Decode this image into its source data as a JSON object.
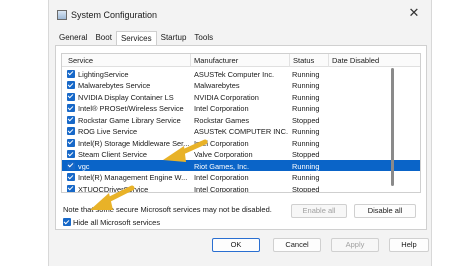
{
  "window": {
    "title": "System Configuration",
    "close_glyph": "✕"
  },
  "tabs": [
    {
      "label": "General",
      "active": false
    },
    {
      "label": "Boot",
      "active": false
    },
    {
      "label": "Services",
      "active": true
    },
    {
      "label": "Startup",
      "active": false
    },
    {
      "label": "Tools",
      "active": false
    }
  ],
  "list": {
    "columns": [
      "Service",
      "Manufacturer",
      "Status",
      "Date Disabled"
    ],
    "rows": [
      {
        "name": "LightingService",
        "manufacturer": "ASUSTek Computer Inc.",
        "status": "Running",
        "checked": true,
        "selected": false
      },
      {
        "name": "Malwarebytes Service",
        "manufacturer": "Malwarebytes",
        "status": "Running",
        "checked": true,
        "selected": false
      },
      {
        "name": "NVIDIA Display Container LS",
        "manufacturer": "NVIDIA Corporation",
        "status": "Running",
        "checked": true,
        "selected": false
      },
      {
        "name": "Intel® PROSet/Wireless Service",
        "manufacturer": "Intel Corporation",
        "status": "Running",
        "checked": true,
        "selected": false
      },
      {
        "name": "Rockstar Game Library Service",
        "manufacturer": "Rockstar Games",
        "status": "Stopped",
        "checked": true,
        "selected": false
      },
      {
        "name": "ROG Live Service",
        "manufacturer": "ASUSTeK COMPUTER INC.",
        "status": "Running",
        "checked": true,
        "selected": false
      },
      {
        "name": "Intel(R) Storage Middleware Ser...",
        "manufacturer": "Intel Corporation",
        "status": "Running",
        "checked": true,
        "selected": false
      },
      {
        "name": "Steam Client Service",
        "manufacturer": "Valve Corporation",
        "status": "Stopped",
        "checked": true,
        "selected": false
      },
      {
        "name": "vgc",
        "manufacturer": "Riot Games, Inc.",
        "status": "Running",
        "checked": true,
        "selected": true
      },
      {
        "name": "Intel(R) Management Engine W...",
        "manufacturer": "Intel Corporation",
        "status": "Running",
        "checked": true,
        "selected": false
      },
      {
        "name": "XTUOCDriverService",
        "manufacturer": "Intel Corporation",
        "status": "Stopped",
        "checked": true,
        "selected": false
      }
    ]
  },
  "note": "Note that some secure Microsoft services may not be disabled.",
  "buttons": {
    "enable_all": "Enable all",
    "disable_all": "Disable all",
    "ok": "OK",
    "cancel": "Cancel",
    "apply": "Apply",
    "help": "Help"
  },
  "hide_ms": {
    "label": "Hide all Microsoft services",
    "checked": true
  },
  "colors": {
    "accent": "#1768c8",
    "selection": "#0a64c8",
    "arrow": "#e8b228"
  },
  "icons": {
    "window": "system-configuration-icon",
    "close": "close-icon"
  }
}
